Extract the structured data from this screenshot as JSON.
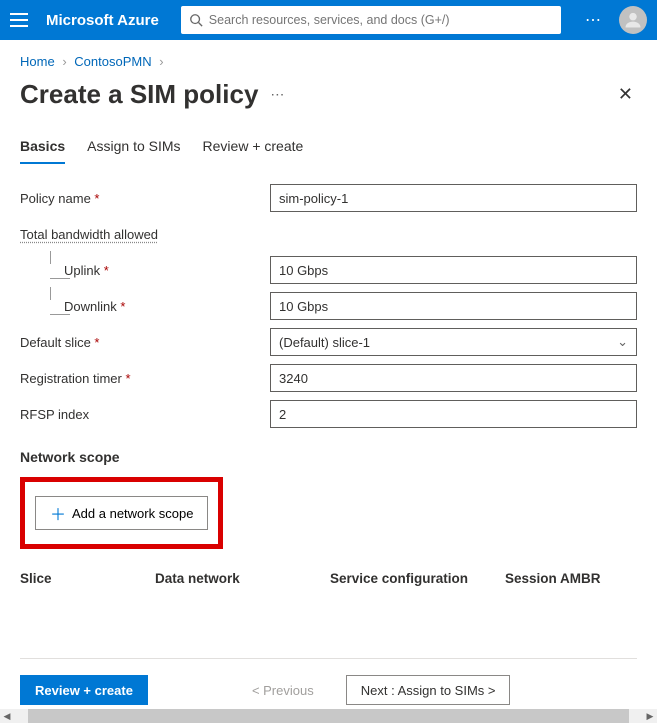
{
  "topbar": {
    "brand": "Microsoft Azure",
    "search_placeholder": "Search resources, services, and docs (G+/)"
  },
  "breadcrumbs": {
    "home": "Home",
    "parent": "ContosoPMN"
  },
  "page": {
    "title": "Create a SIM policy"
  },
  "tabs": {
    "basics": "Basics",
    "assign": "Assign to SIMs",
    "review": "Review + create"
  },
  "form": {
    "policy_name_label": "Policy name",
    "policy_name_value": "sim-policy-1",
    "total_bw_label": "Total bandwidth allowed",
    "uplink_label": "Uplink",
    "uplink_value": "10 Gbps",
    "downlink_label": "Downlink",
    "downlink_value": "10 Gbps",
    "default_slice_label": "Default slice",
    "default_slice_value": "(Default) slice-1",
    "reg_timer_label": "Registration timer",
    "reg_timer_value": "3240",
    "rfsp_label": "RFSP index",
    "rfsp_value": "2"
  },
  "network_scope": {
    "heading": "Network scope",
    "add_button": "Add a network scope",
    "columns": {
      "slice": "Slice",
      "data_network": "Data network",
      "service_config": "Service configuration",
      "session_ambr": "Session AMBR"
    }
  },
  "footer": {
    "review_create": "Review + create",
    "previous": "< Previous",
    "next": "Next : Assign to SIMs >"
  }
}
